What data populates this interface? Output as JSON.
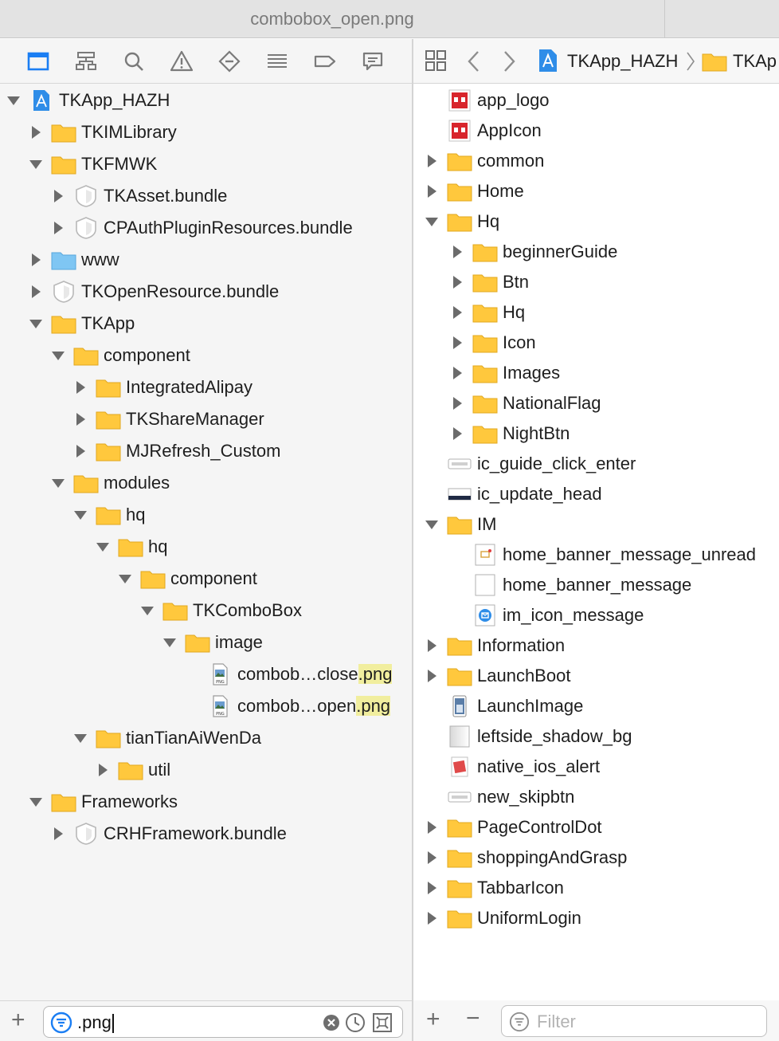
{
  "window": {
    "title": "combobox_open.png"
  },
  "left_toolbar": {
    "icons": [
      "folder-icon",
      "hierarchy-icon",
      "search-icon",
      "warning-icon",
      "breakpoint-icon",
      "list-icon",
      "tag-icon",
      "comment-icon"
    ]
  },
  "left_tree": [
    {
      "label": "TKApp_HAZH",
      "depth": 0,
      "icon": "project-icon",
      "disclosure": "open"
    },
    {
      "label": "TKIMLibrary",
      "depth": 1,
      "icon": "folder-icon",
      "disclosure": "closed"
    },
    {
      "label": "TKFMWK",
      "depth": 1,
      "icon": "folder-icon",
      "disclosure": "open"
    },
    {
      "label": "TKAsset.bundle",
      "depth": 2,
      "icon": "bundle-icon",
      "disclosure": "closed"
    },
    {
      "label": "CPAuthPluginResources.bundle",
      "depth": 2,
      "icon": "bundle-icon",
      "disclosure": "closed"
    },
    {
      "label": "www",
      "depth": 1,
      "icon": "blue-folder-icon",
      "disclosure": "closed"
    },
    {
      "label": "TKOpenResource.bundle",
      "depth": 1,
      "icon": "bundle-icon",
      "disclosure": "closed"
    },
    {
      "label": "TKApp",
      "depth": 1,
      "icon": "folder-icon",
      "disclosure": "open"
    },
    {
      "label": "component",
      "depth": 2,
      "icon": "folder-icon",
      "disclosure": "open"
    },
    {
      "label": "IntegratedAlipay",
      "depth": 3,
      "icon": "folder-icon",
      "disclosure": "closed"
    },
    {
      "label": "TKShareManager",
      "depth": 3,
      "icon": "folder-icon",
      "disclosure": "closed"
    },
    {
      "label": "MJRefresh_Custom",
      "depth": 3,
      "icon": "folder-icon",
      "disclosure": "closed"
    },
    {
      "label": "modules",
      "depth": 2,
      "icon": "folder-icon",
      "disclosure": "open"
    },
    {
      "label": "hq",
      "depth": 3,
      "icon": "folder-icon",
      "disclosure": "open"
    },
    {
      "label": "hq",
      "depth": 4,
      "icon": "folder-icon",
      "disclosure": "open"
    },
    {
      "label": "component",
      "depth": 5,
      "icon": "folder-icon",
      "disclosure": "open"
    },
    {
      "label": "TKComboBox",
      "depth": 6,
      "icon": "folder-icon",
      "disclosure": "open"
    },
    {
      "label": "image",
      "depth": 7,
      "icon": "folder-icon",
      "disclosure": "open"
    },
    {
      "label": "combob…close",
      "highlight": ".png",
      "depth": 8,
      "icon": "png-file-icon",
      "disclosure": "none"
    },
    {
      "label": "combob…open",
      "highlight": ".png",
      "depth": 8,
      "icon": "png-file-icon",
      "disclosure": "none"
    },
    {
      "label": "tianTianAiWenDa",
      "depth": 3,
      "icon": "folder-icon",
      "disclosure": "open"
    },
    {
      "label": "util",
      "depth": 4,
      "icon": "folder-icon",
      "disclosure": "closed"
    },
    {
      "label": "Frameworks",
      "depth": 1,
      "icon": "folder-icon",
      "disclosure": "open"
    },
    {
      "label": "CRHFramework.bundle",
      "depth": 2,
      "icon": "bundle-icon",
      "disclosure": "closed"
    }
  ],
  "left_filter": {
    "value": ".png"
  },
  "right_toolbar": {
    "crumb_project": "TKApp_HAZH",
    "crumb_next": "TKAp"
  },
  "right_tree": [
    {
      "label": "app_logo",
      "depth": 0,
      "icon": "red-image-icon",
      "disclosure": "none"
    },
    {
      "label": "AppIcon",
      "depth": 0,
      "icon": "red-image-icon",
      "disclosure": "none"
    },
    {
      "label": "common",
      "depth": 0,
      "icon": "folder-icon",
      "disclosure": "closed"
    },
    {
      "label": "Home",
      "depth": 0,
      "icon": "folder-icon",
      "disclosure": "closed"
    },
    {
      "label": "Hq",
      "depth": 0,
      "icon": "folder-icon",
      "disclosure": "open"
    },
    {
      "label": "beginnerGuide",
      "depth": 1,
      "icon": "folder-icon",
      "disclosure": "closed"
    },
    {
      "label": "Btn",
      "depth": 1,
      "icon": "folder-icon",
      "disclosure": "closed"
    },
    {
      "label": "Hq",
      "depth": 1,
      "icon": "folder-icon",
      "disclosure": "closed"
    },
    {
      "label": "Icon",
      "depth": 1,
      "icon": "folder-icon",
      "disclosure": "closed"
    },
    {
      "label": "Images",
      "depth": 1,
      "icon": "folder-icon",
      "disclosure": "closed"
    },
    {
      "label": "NationalFlag",
      "depth": 1,
      "icon": "folder-icon",
      "disclosure": "closed"
    },
    {
      "label": "NightBtn",
      "depth": 1,
      "icon": "folder-icon",
      "disclosure": "closed"
    },
    {
      "label": "ic_guide_click_enter",
      "depth": 0,
      "icon": "button-image-icon",
      "disclosure": "none"
    },
    {
      "label": "ic_update_head",
      "depth": 0,
      "icon": "dark-image-icon",
      "disclosure": "none"
    },
    {
      "label": "IM",
      "depth": 0,
      "icon": "folder-icon",
      "disclosure": "open"
    },
    {
      "label": "home_banner_message_unread",
      "depth": 1,
      "icon": "message-unread-icon",
      "disclosure": "none"
    },
    {
      "label": "home_banner_message",
      "depth": 1,
      "icon": "blank-image-icon",
      "disclosure": "none"
    },
    {
      "label": "im_icon_message",
      "depth": 1,
      "icon": "blue-message-icon",
      "disclosure": "none"
    },
    {
      "label": "Information",
      "depth": 0,
      "icon": "folder-icon",
      "disclosure": "closed"
    },
    {
      "label": "LaunchBoot",
      "depth": 0,
      "icon": "folder-icon",
      "disclosure": "closed"
    },
    {
      "label": "LaunchImage",
      "depth": 0,
      "icon": "launch-image-icon",
      "disclosure": "none"
    },
    {
      "label": "leftside_shadow_bg",
      "depth": 0,
      "icon": "gradient-image-icon",
      "disclosure": "none"
    },
    {
      "label": "native_ios_alert",
      "depth": 0,
      "icon": "alert-image-icon",
      "disclosure": "none"
    },
    {
      "label": "new_skipbtn",
      "depth": 0,
      "icon": "button-image-icon",
      "disclosure": "none"
    },
    {
      "label": "PageControlDot",
      "depth": 0,
      "icon": "folder-icon",
      "disclosure": "closed"
    },
    {
      "label": "shoppingAndGrasp",
      "depth": 0,
      "icon": "folder-icon",
      "disclosure": "closed"
    },
    {
      "label": "TabbarIcon",
      "depth": 0,
      "icon": "folder-icon",
      "disclosure": "closed"
    },
    {
      "label": "UniformLogin",
      "depth": 0,
      "icon": "folder-icon",
      "disclosure": "closed"
    }
  ],
  "right_filter": {
    "placeholder": "Filter"
  },
  "colors": {
    "folder": "#ffc83d",
    "accent": "#1b7ef3",
    "highlight": "#f1ee9e"
  }
}
